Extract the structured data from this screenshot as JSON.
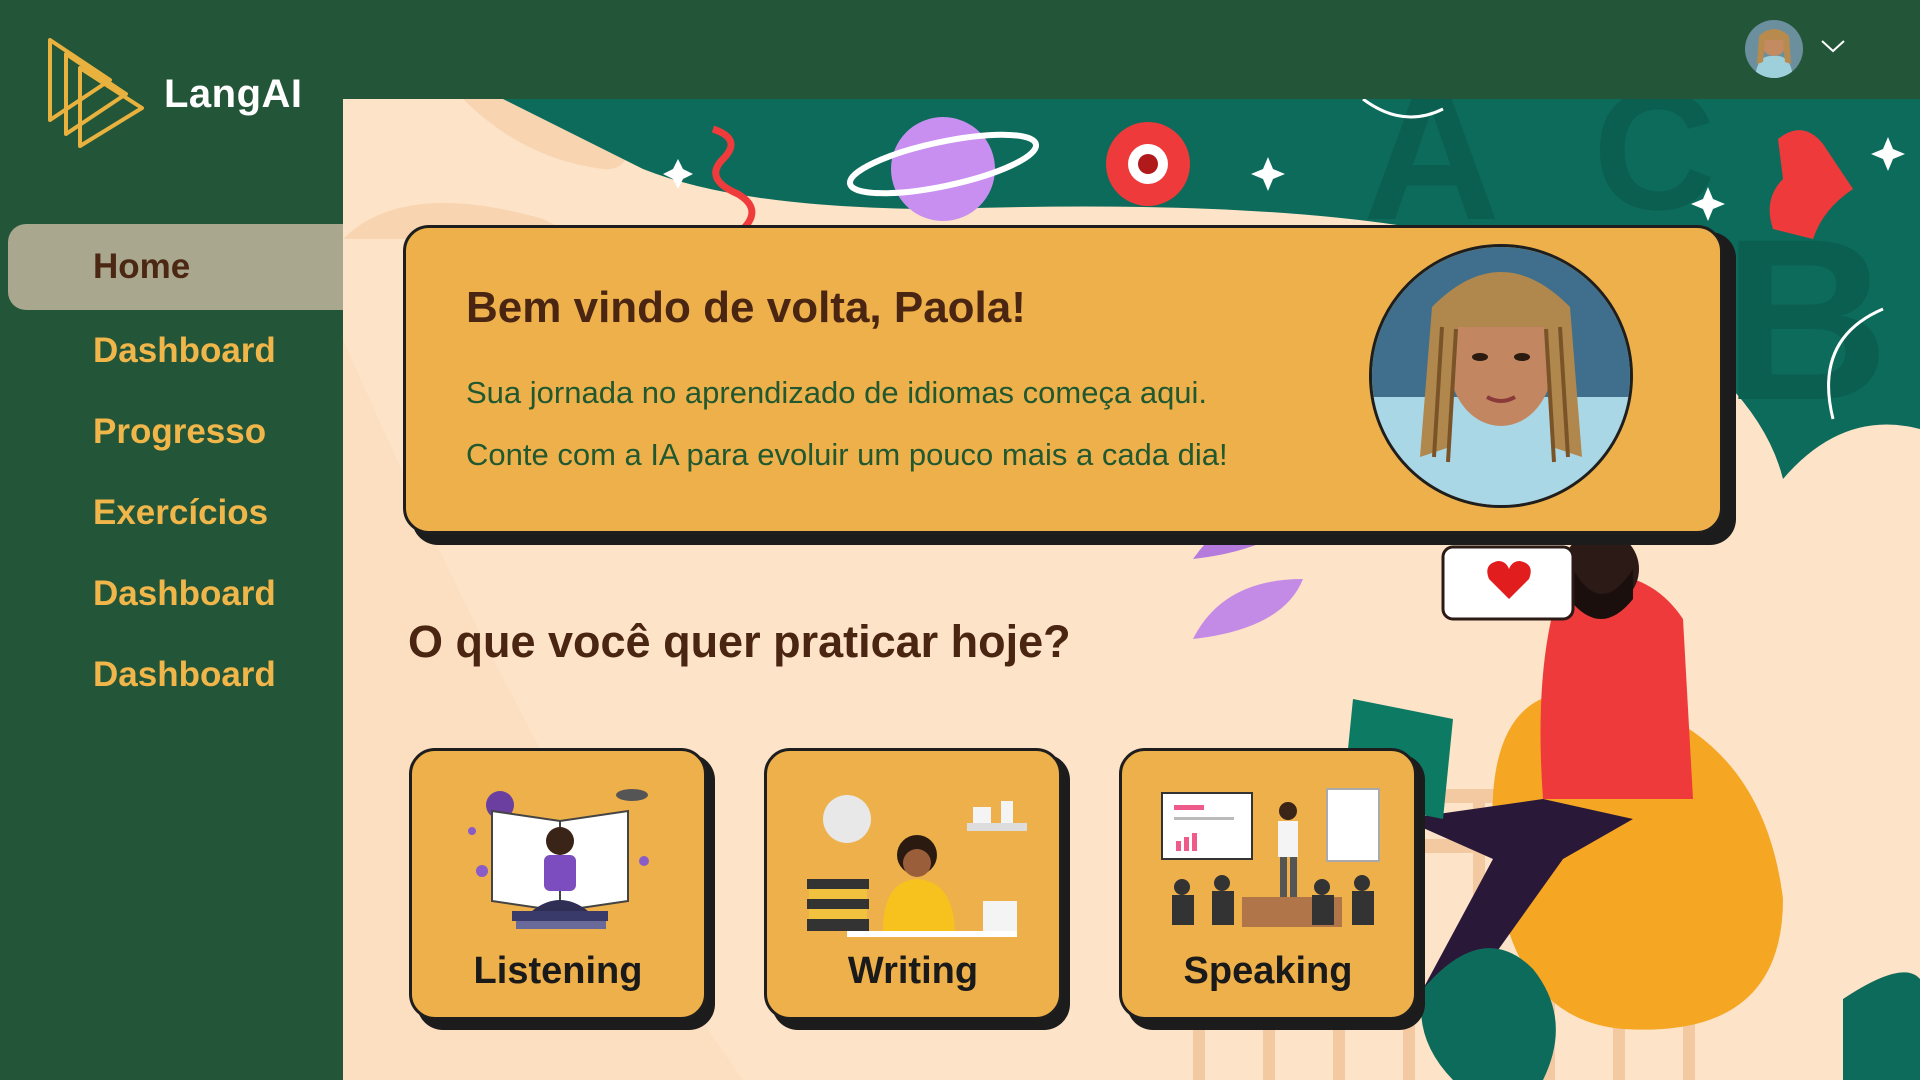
{
  "app": {
    "brand": "LangAI"
  },
  "sidebar": {
    "items": [
      {
        "label": "Home",
        "active": true
      },
      {
        "label": "Dashboard"
      },
      {
        "label": "Progresso"
      },
      {
        "label": "Exercícios"
      },
      {
        "label": "Dashboard"
      },
      {
        "label": "Dashboard"
      }
    ]
  },
  "header": {
    "avatar_icon": "user-avatar",
    "menu_icon": "chevron-down-icon"
  },
  "welcome": {
    "title": "Bem vindo de volta, Paola!",
    "line1": "Sua jornada no aprendizado de idiomas começa aqui.",
    "line2": "Conte com a IA para evoluir um pouco mais a cada dia!"
  },
  "practice": {
    "heading": "O que você quer praticar hoje?",
    "cards": [
      {
        "label": "Listening"
      },
      {
        "label": "Writing"
      },
      {
        "label": "Speaking"
      }
    ]
  },
  "colors": {
    "sidebar": "#235638",
    "accent": "#edb04a",
    "nav_text": "#f1b64a",
    "title_brown": "#4a2512",
    "background": "#fde3c7"
  }
}
